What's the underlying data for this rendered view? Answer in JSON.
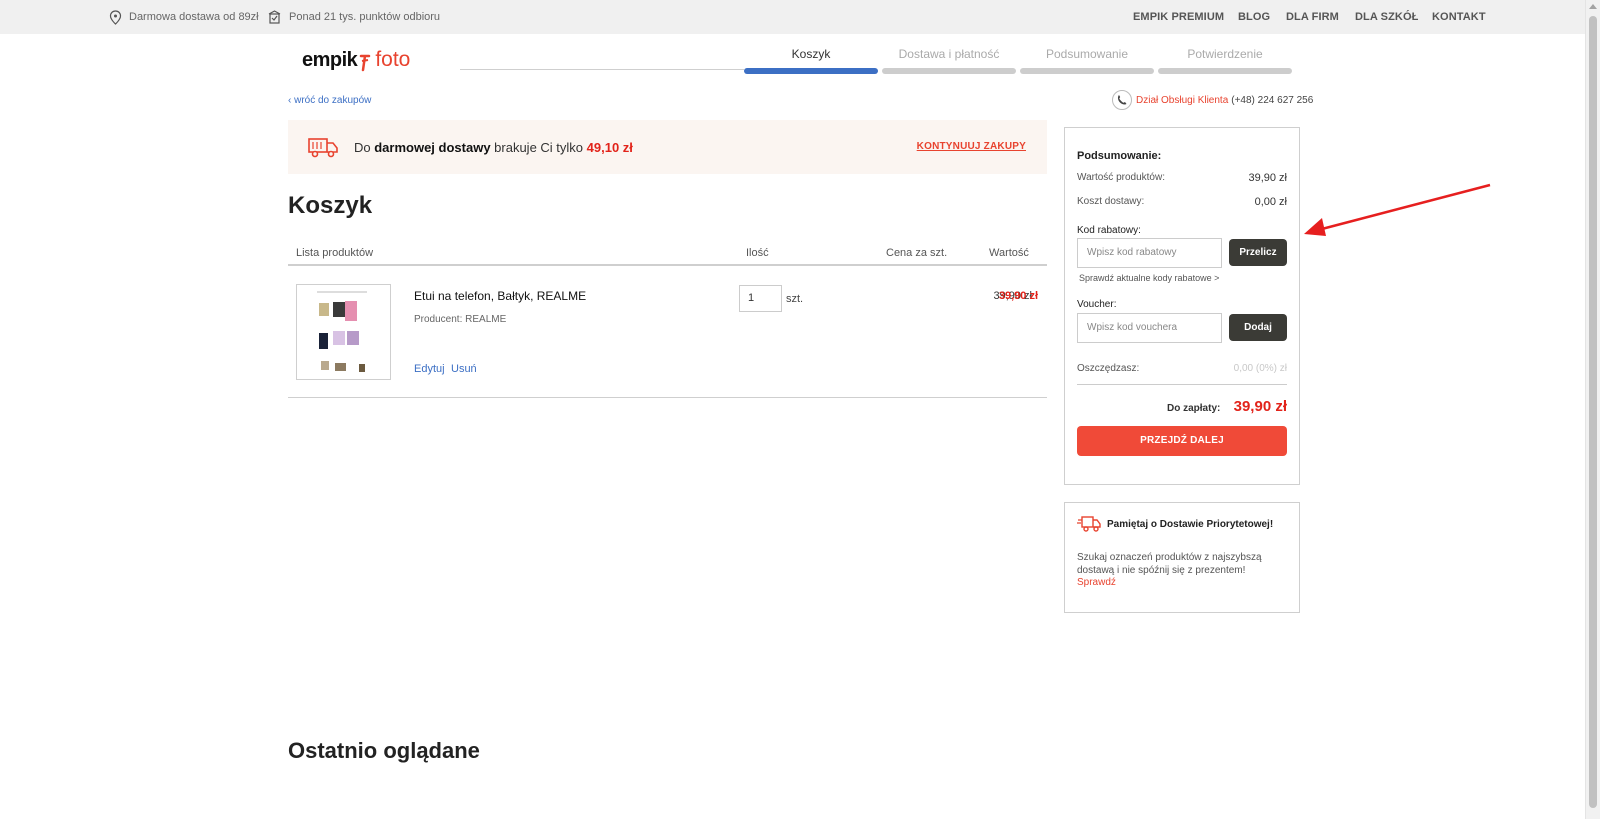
{
  "topbar": {
    "free_delivery": "Darmowa dostawa od 89zł",
    "pickup_points": "Ponad 21 tys. punktów odbioru",
    "links": [
      "EMPIK PREMIUM",
      "BLOG",
      "DLA FIRM",
      "DLA SZKÓŁ",
      "KONTAKT"
    ]
  },
  "logo": {
    "brand": "empik",
    "sub": "foto"
  },
  "steps": [
    {
      "label": "Koszyk",
      "active": true
    },
    {
      "label": "Dostawa i płatność",
      "active": false
    },
    {
      "label": "Podsumowanie",
      "active": false
    },
    {
      "label": "Potwierdzenie",
      "active": false
    }
  ],
  "back_link": "‹ wróć do zakupów",
  "service": {
    "label": "Dział Obsługi Klienta",
    "phone": "(+48) 224 627 256"
  },
  "banner": {
    "prefix": "Do ",
    "bold": "darmowej dostawy",
    "middle": " brakuje Ci tylko ",
    "amount": "49,10 zł",
    "continue": "KONTYNUUJ ZAKUPY"
  },
  "cart": {
    "title": "Koszyk",
    "columns": {
      "products": "Lista produktów",
      "qty": "Ilość",
      "unit_price": "Cena za szt.",
      "value": "Wartość"
    },
    "items": [
      {
        "name": "Etui na telefon, Bałtyk, REALME",
        "producer": "Producent: REALME",
        "qty": "1",
        "qty_unit": "szt.",
        "unit_price": "39,90 zł",
        "total": "39,90 zł",
        "edit": "Edytuj",
        "remove": "Usuń"
      }
    ]
  },
  "summary": {
    "title": "Podsumowanie:",
    "products_label": "Wartość produktów:",
    "products_value": "39,90 zł",
    "delivery_label": "Koszt dostawy:",
    "delivery_value": "0,00 zł",
    "discount_label": "Kod rabatowy:",
    "discount_placeholder": "Wpisz kod rabatowy",
    "discount_button": "Przelicz",
    "discount_link": "Sprawdź aktualne kody rabatowe >",
    "voucher_label": "Voucher:",
    "voucher_placeholder": "Wpisz kod vouchera",
    "voucher_button": "Dodaj",
    "savings_label": "Oszczędzasz:",
    "savings_value": "0,00 (0%) zł",
    "pay_label": "Do zapłaty:",
    "pay_value": "39,90 zł",
    "next_button": "PRZEJDŹ DALEJ"
  },
  "priority": {
    "title": "Pamiętaj o Dostawie Priorytetowej!",
    "text": "Szukaj oznaczeń produktów z najszybszą dostawą i nie spóźnij się z prezentem!",
    "link": "Sprawdź"
  },
  "recent": {
    "title": "Ostatnio oglądane"
  },
  "colors": {
    "accent_red": "#e8432f",
    "price_red": "#e2231a",
    "step_blue": "#3c6fc4",
    "dark_button": "#3b3b36"
  }
}
